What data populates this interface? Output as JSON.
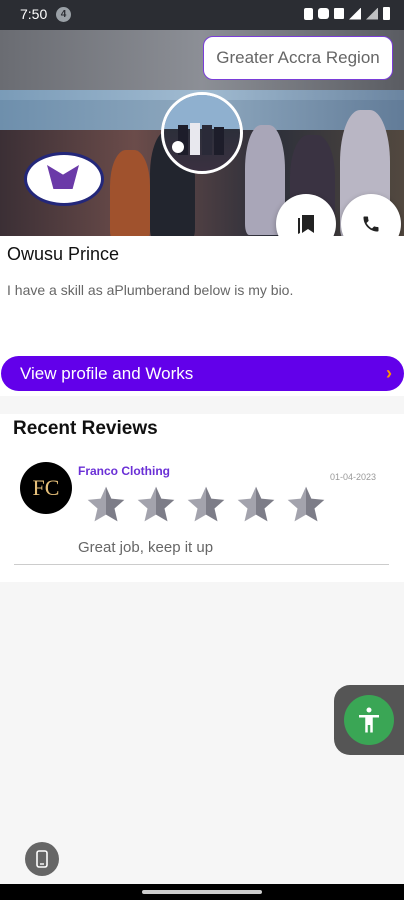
{
  "status": {
    "time": "7:50",
    "badge": "4"
  },
  "header": {
    "region": "Greater Accra Region"
  },
  "profile": {
    "name": "Owusu Prince",
    "bio": "I have a skill as aPlumberand below is my bio.",
    "view_button": "View profile and Works"
  },
  "reviews": {
    "title": "Recent Reviews",
    "items": [
      {
        "reviewer": "Franco Clothing",
        "logo_text": "FC",
        "date": "01-04-2023",
        "rating": 5,
        "max_rating": 5,
        "comment": "Great job, keep it up"
      }
    ]
  },
  "icons": {
    "bookmark": "bookmark-icon",
    "call": "phone-icon",
    "accessibility": "accessibility-icon",
    "device": "phone-device-icon"
  },
  "colors": {
    "accent": "#6200ea",
    "reviewer_name": "#6a2fd6",
    "chevron": "#ff9800",
    "accessibility": "#3aa655"
  }
}
